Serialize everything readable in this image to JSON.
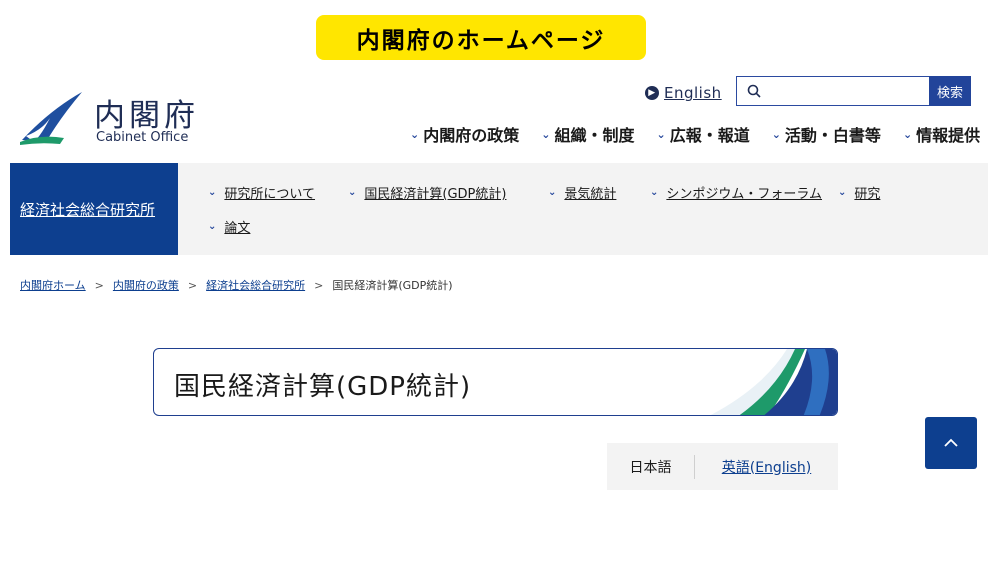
{
  "caption": "内閣府のホームページ",
  "logo": {
    "jp": "内閣府",
    "en": "Cabinet Office"
  },
  "header": {
    "english_link": "English",
    "search": {
      "placeholder": "",
      "button": "検索"
    },
    "global_nav": [
      "内閣府の政策",
      "組織・制度",
      "広報・報道",
      "活動・白書等",
      "情報提供"
    ]
  },
  "subnav": {
    "title": "経済社会総合研究所",
    "links": [
      "研究所について",
      "国民経済計算(GDP統計)",
      "景気統計",
      "シンポジウム・フォーラム",
      "研究",
      "論文"
    ]
  },
  "breadcrumb": [
    "内閣府ホーム",
    "内閣府の政策",
    "経済社会総合研究所",
    "国民経済計算(GDP統計)"
  ],
  "page": {
    "title": "国民経済計算(GDP統計)"
  },
  "lang_switch": {
    "current": "日本語",
    "english": "英語(English)"
  },
  "colors": {
    "navy": "#0d3f8f",
    "caption_yellow": "#ffe600",
    "band_gray": "#f3f3f3"
  }
}
